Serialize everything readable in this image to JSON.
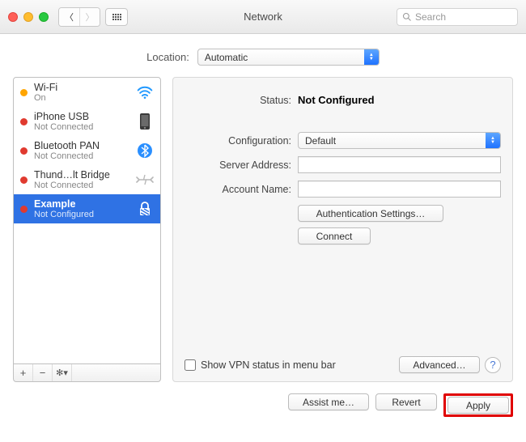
{
  "window": {
    "title": "Network",
    "search_placeholder": "Search"
  },
  "location": {
    "label": "Location:",
    "value": "Automatic"
  },
  "services": [
    {
      "name": "Wi-Fi",
      "status": "On",
      "dot": "orange",
      "icon": "wifi"
    },
    {
      "name": "iPhone USB",
      "status": "Not Connected",
      "dot": "red",
      "icon": "phone"
    },
    {
      "name": "Bluetooth PAN",
      "status": "Not Connected",
      "dot": "red",
      "icon": "bluetooth"
    },
    {
      "name": "Thund…lt Bridge",
      "status": "Not Connected",
      "dot": "red",
      "icon": "thunderbolt"
    },
    {
      "name": "Example",
      "status": "Not Configured",
      "dot": "red",
      "icon": "lock",
      "selected": true
    }
  ],
  "detail": {
    "status_label": "Status:",
    "status_value": "Not Configured",
    "configuration_label": "Configuration:",
    "configuration_value": "Default",
    "server_label": "Server Address:",
    "server_value": "",
    "account_label": "Account Name:",
    "account_value": "",
    "auth_button": "Authentication Settings…",
    "connect_button": "Connect",
    "show_vpn_label": "Show VPN status in menu bar",
    "show_vpn_checked": false,
    "advanced_button": "Advanced…"
  },
  "footer": {
    "assist": "Assist me…",
    "revert": "Revert",
    "apply": "Apply"
  }
}
